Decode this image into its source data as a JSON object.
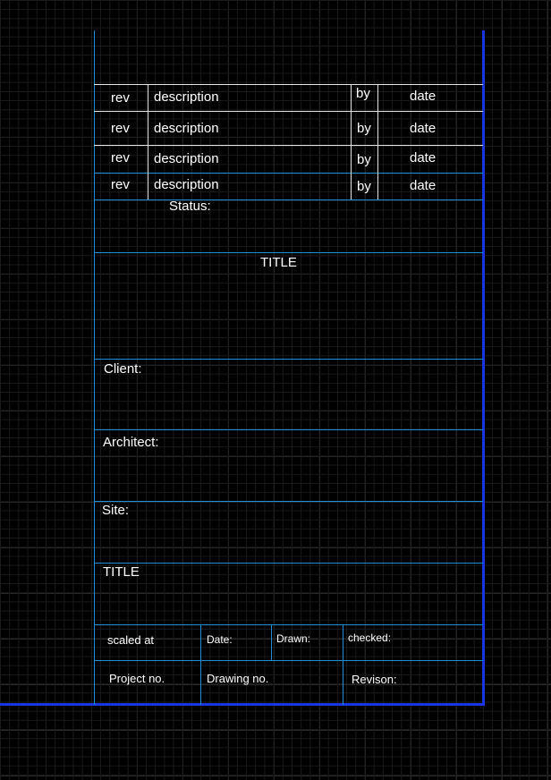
{
  "colors": {
    "background": "#000000",
    "grid_line": "#1a1a1a",
    "frame_line": "#1e8fd6",
    "revision_row_line": "#e6e6e6",
    "border_heavy": "#1a34e0",
    "text": "#ffffff"
  },
  "revisions": [
    {
      "rev": "rev",
      "description": "description",
      "by": "by",
      "date": "date"
    },
    {
      "rev": "rev",
      "description": "description",
      "by": "by",
      "date": "date"
    },
    {
      "rev": "rev",
      "description": "description",
      "by": "by",
      "date": "date"
    },
    {
      "rev": "rev",
      "description": "description",
      "by": "by",
      "date": "date"
    }
  ],
  "status_label": "Status:",
  "drawing_title": "TITLE",
  "client_label": "Client:",
  "architect_label": "Architect:",
  "site_label": "Site:",
  "project_title": "TITLE",
  "footer": {
    "scale_label": "scaled at",
    "date_label": "Date:",
    "drawn_label": "Drawn:",
    "checked_label": "checked:",
    "project_no_label": "Project no.",
    "drawing_no_label": "Drawing no.",
    "revision_label": "Revison:"
  }
}
